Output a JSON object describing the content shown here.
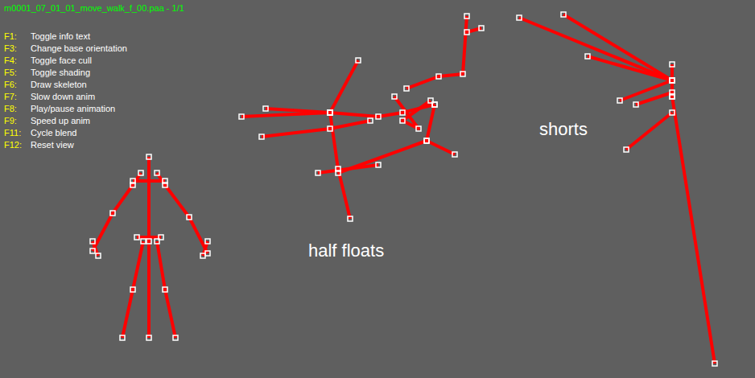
{
  "window": {
    "title": "m0001_07_01_01_move_walk_f_00.paa - 1/1"
  },
  "help": [
    {
      "key": "F1:",
      "label": "Toggle info text"
    },
    {
      "key": "F3:",
      "label": "Change base orientation"
    },
    {
      "key": "F4:",
      "label": "Toggle face cull"
    },
    {
      "key": "F5:",
      "label": "Toggle shading"
    },
    {
      "key": "F6:",
      "label": "Draw skeleton"
    },
    {
      "key": "F7:",
      "label": "Slow down anim"
    },
    {
      "key": "F8:",
      "label": "Play/pause animation"
    },
    {
      "key": "F9:",
      "label": "Speed up anim"
    },
    {
      "key": "F11:",
      "label": "Cycle blend"
    },
    {
      "key": "F12:",
      "label": "Reset view"
    }
  ],
  "annotations": [
    {
      "text": "half floats"
    },
    {
      "text": "shorts"
    }
  ]
}
